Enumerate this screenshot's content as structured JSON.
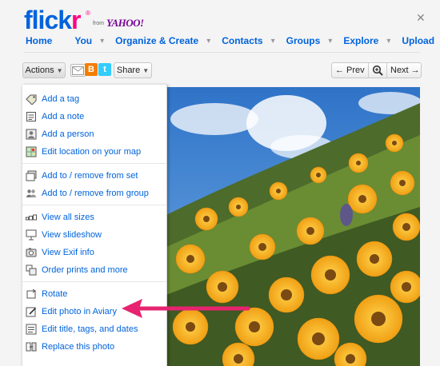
{
  "brand": {
    "logo_part1": "flick",
    "logo_part2": "r",
    "reg": "®",
    "from": "from",
    "yahoo": "YAHOO!"
  },
  "nav": {
    "home": "Home",
    "you": "You",
    "organize": "Organize & Create",
    "contacts": "Contacts",
    "groups": "Groups",
    "explore": "Explore",
    "upload": "Upload"
  },
  "toolbar": {
    "actions_label": "Actions",
    "share_label": "Share",
    "prev_label": "← Prev",
    "next_label": "Next →"
  },
  "menu": {
    "groups": [
      [
        {
          "label": "Add a tag",
          "icon": "tag-icon"
        },
        {
          "label": "Add a note",
          "icon": "note-icon"
        },
        {
          "label": "Add a person",
          "icon": "person-icon"
        },
        {
          "label": "Edit location on your map",
          "icon": "map-icon"
        }
      ],
      [
        {
          "label": "Add to / remove from set",
          "icon": "set-icon"
        },
        {
          "label": "Add to / remove from group",
          "icon": "group-icon"
        }
      ],
      [
        {
          "label": "View all sizes",
          "icon": "sizes-icon"
        },
        {
          "label": "View slideshow",
          "icon": "slideshow-icon"
        },
        {
          "label": "View Exif info",
          "icon": "exif-icon"
        },
        {
          "label": "Order prints and more",
          "icon": "prints-icon"
        }
      ],
      [
        {
          "label": "Rotate",
          "icon": "rotate-icon"
        },
        {
          "label": "Edit photo in Aviary",
          "icon": "aviary-edit-icon"
        },
        {
          "label": "Edit title, tags, and dates",
          "icon": "edit-title-icon"
        },
        {
          "label": "Replace this photo",
          "icon": "replace-icon"
        }
      ]
    ]
  },
  "colors": {
    "link": "#0063dc",
    "brand_pink": "#ff0084",
    "arrow": "#e6246f"
  }
}
